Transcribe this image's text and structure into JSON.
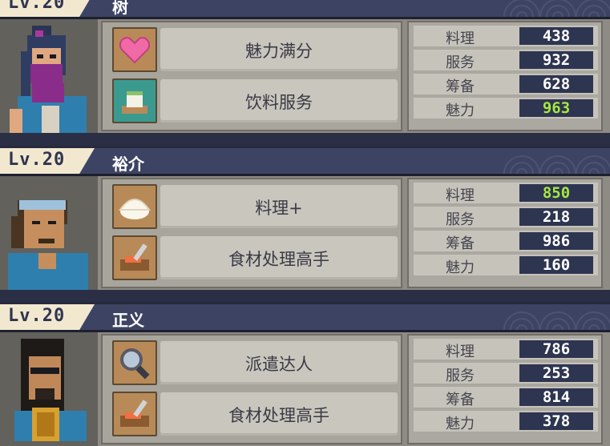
{
  "characters": [
    {
      "level": "Lv.20",
      "name": "树",
      "skills": [
        {
          "label": "魅力满分",
          "icon": "heart-icon",
          "icon_bg": "brown"
        },
        {
          "label": "饮料服务",
          "icon": "tea-cup-icon",
          "icon_bg": "teal"
        }
      ],
      "stats": [
        {
          "label": "料理",
          "value": "438",
          "highlight": false
        },
        {
          "label": "服务",
          "value": "932",
          "highlight": false
        },
        {
          "label": "筹备",
          "value": "628",
          "highlight": false
        },
        {
          "label": "魅力",
          "value": "963",
          "highlight": true
        }
      ]
    },
    {
      "level": "Lv.20",
      "name": "裕介",
      "skills": [
        {
          "label": "料理+",
          "icon": "rice-bun-icon",
          "icon_bg": "brown"
        },
        {
          "label": "食材处理高手",
          "icon": "knife-board-icon",
          "icon_bg": "brown"
        }
      ],
      "stats": [
        {
          "label": "料理",
          "value": "850",
          "highlight": true
        },
        {
          "label": "服务",
          "value": "218",
          "highlight": false
        },
        {
          "label": "筹备",
          "value": "986",
          "highlight": false
        },
        {
          "label": "魅力",
          "value": "160",
          "highlight": false
        }
      ]
    },
    {
      "level": "Lv.20",
      "name": "正义",
      "skills": [
        {
          "label": "派遣达人",
          "icon": "magnifier-icon",
          "icon_bg": "brown"
        },
        {
          "label": "食材处理高手",
          "icon": "knife-board-icon",
          "icon_bg": "brown"
        }
      ],
      "stats": [
        {
          "label": "料理",
          "value": "786",
          "highlight": false
        },
        {
          "label": "服务",
          "value": "253",
          "highlight": false
        },
        {
          "label": "筹备",
          "value": "814",
          "highlight": false
        },
        {
          "label": "魅力",
          "value": "378",
          "highlight": false
        }
      ]
    }
  ],
  "colors": {
    "header": "#3d4463",
    "level_tab": "#f2e8cf",
    "stat_value_bg": "#2e3550",
    "stat_highlight": "#a6e93e"
  }
}
